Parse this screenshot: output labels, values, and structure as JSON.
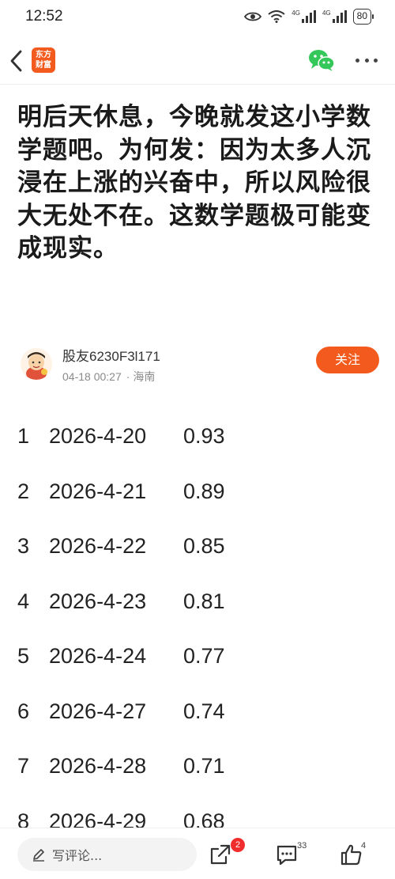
{
  "status_bar": {
    "time": "12:52",
    "network_1": "4G",
    "network_2": "4G",
    "battery": "80"
  },
  "nav": {
    "app_logo_line1": "东方",
    "app_logo_line2": "财富",
    "icons": [
      "back-arrow",
      "wechat",
      "more"
    ]
  },
  "post": {
    "title": "明后天休息，今晚就发这小学数学题吧。为何发：因为太多人沉浸在上涨的兴奋中，所以风险很大无处不在。这数学题极可能变成现实。",
    "author_name": "股友6230F3l171",
    "timestamp": "04-18 00:27",
    "location": "海南",
    "follow_label": "关注"
  },
  "rows": [
    {
      "n": "1",
      "date": "2026-4-20",
      "value": "0.93"
    },
    {
      "n": "2",
      "date": "2026-4-21",
      "value": "0.89"
    },
    {
      "n": "3",
      "date": "2026-4-22",
      "value": "0.85"
    },
    {
      "n": "4",
      "date": "2026-4-23",
      "value": "0.81"
    },
    {
      "n": "5",
      "date": "2026-4-24",
      "value": "0.77"
    },
    {
      "n": "6",
      "date": "2026-4-27",
      "value": "0.74"
    },
    {
      "n": "7",
      "date": "2026-4-28",
      "value": "0.71"
    },
    {
      "n": "8",
      "date": "2026-4-29",
      "value": "0.68"
    }
  ],
  "bottom_bar": {
    "comment_placeholder": "写评论...",
    "share_badge": "2",
    "comment_count": "33",
    "like_count": "4"
  },
  "colors": {
    "accent": "#f25b1d",
    "badge": "#f02d2d",
    "wechat": "#34c759"
  }
}
